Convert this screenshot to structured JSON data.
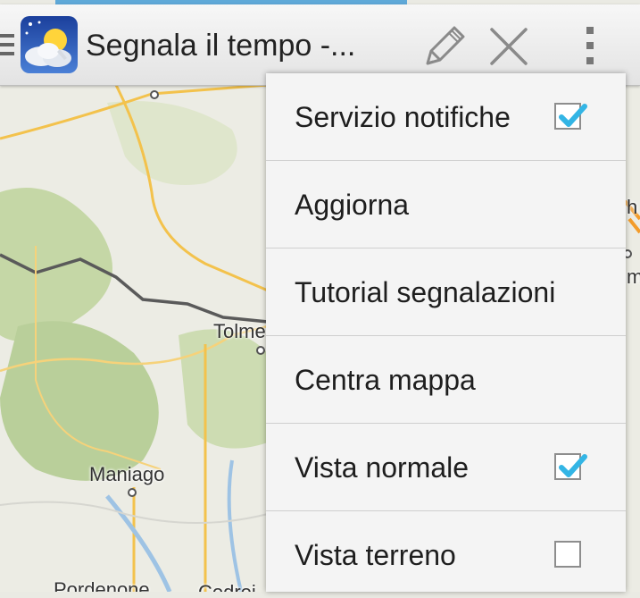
{
  "header": {
    "progress": 1.0,
    "title": "Segnala il tempo -...",
    "icons": {
      "drawer": "drawer-icon",
      "app": "weather-app-icon",
      "edit": "pencil-icon",
      "close": "close-icon",
      "overflow": "overflow-menu-icon"
    }
  },
  "map": {
    "labels": [
      "Tolme",
      "Maniago",
      "Pordenone",
      "Codroi",
      "h",
      "m"
    ]
  },
  "menu": {
    "items": [
      {
        "label": "Servizio notifiche",
        "checkbox": true,
        "checked": true
      },
      {
        "label": "Aggiorna",
        "checkbox": false
      },
      {
        "label": "Tutorial segnalazioni",
        "checkbox": false
      },
      {
        "label": "Centra mappa",
        "checkbox": false
      },
      {
        "label": "Vista normale",
        "checkbox": true,
        "checked": true
      },
      {
        "label": "Vista terreno",
        "checkbox": true,
        "checked": false
      }
    ]
  },
  "colors": {
    "accent": "#33b5e5",
    "road": "#f3c24c",
    "border": "#555555",
    "terrain": "#b9cf9a"
  }
}
